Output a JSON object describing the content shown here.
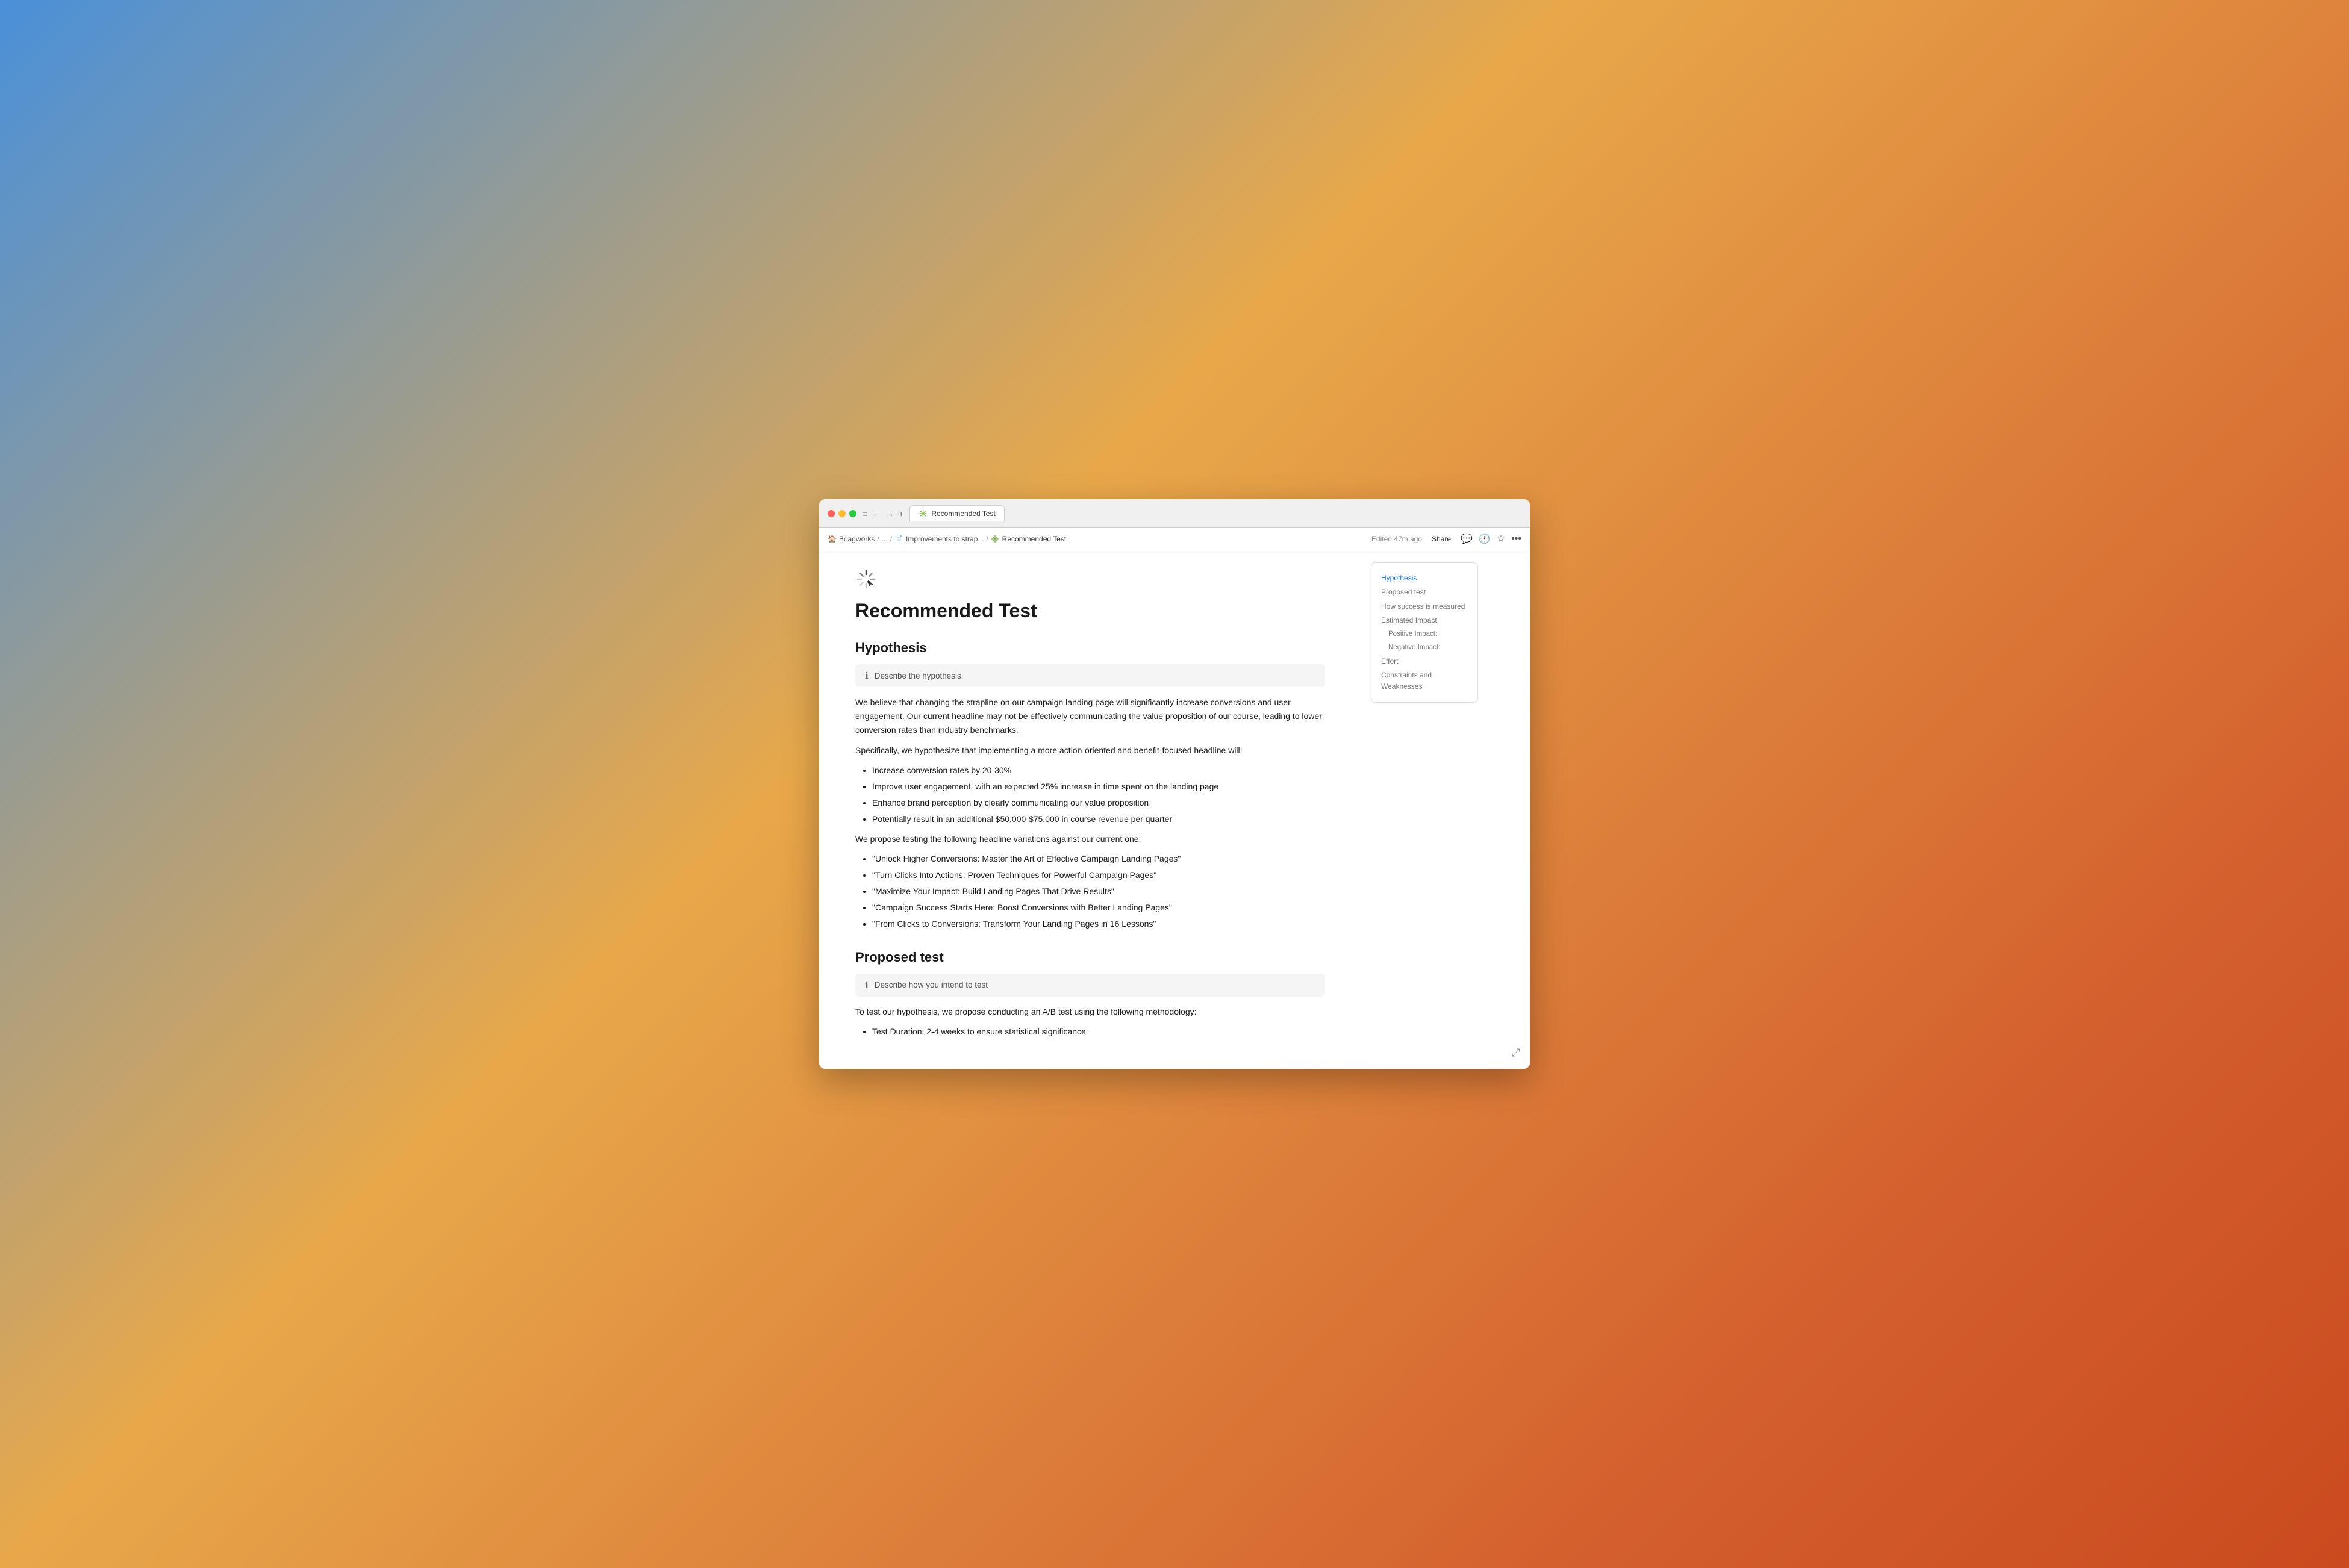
{
  "browser": {
    "tab_title": "Recommended Test",
    "tab_icon": "✳️",
    "nav_buttons": [
      "◉",
      "◉",
      "◉"
    ],
    "traffic_lights": [
      "red",
      "yellow",
      "green"
    ],
    "controls": [
      "≡",
      "←",
      "→",
      "+"
    ]
  },
  "breadcrumb": {
    "items": [
      {
        "label": "Boagworks",
        "icon": "🏠",
        "sep": "/"
      },
      {
        "label": "...",
        "sep": "/"
      },
      {
        "label": "Improvements to strap...",
        "icon": "📄",
        "sep": "/"
      },
      {
        "label": "Recommended Test",
        "icon": "✳️",
        "active": true
      }
    ]
  },
  "toolbar_right": {
    "edited_label": "Edited 47m ago",
    "share_label": "Share",
    "icons": [
      "💬",
      "🕐",
      "☆",
      "•••"
    ]
  },
  "toc": {
    "items": [
      {
        "label": "Hypothesis",
        "active": true,
        "sub": false
      },
      {
        "label": "Proposed test",
        "active": false,
        "sub": false
      },
      {
        "label": "How success is measured",
        "active": false,
        "sub": false
      },
      {
        "label": "Estimated Impact",
        "active": false,
        "sub": false
      },
      {
        "label": "Positive Impact:",
        "active": false,
        "sub": true
      },
      {
        "label": "Negative Impact:",
        "active": false,
        "sub": true
      },
      {
        "label": "Effort",
        "active": false,
        "sub": false
      },
      {
        "label": "Constraints and Weaknesses",
        "active": false,
        "sub": false
      }
    ]
  },
  "page": {
    "title": "Recommended Test",
    "hypothesis": {
      "heading": "Hypothesis",
      "hint": "Describe the hypothesis.",
      "paragraph1": "We believe that changing the strapline on our campaign landing page will significantly increase conversions and user engagement. Our current headline may not be effectively communicating the value proposition of our course, leading to lower conversion rates than industry benchmarks.",
      "paragraph2": "Specifically, we hypothesize that implementing a more action-oriented and benefit-focused headline will:",
      "bullets1": [
        "Increase conversion rates by 20-30%",
        "Improve user engagement, with an expected 25% increase in time spent on the landing page",
        "Enhance brand perception by clearly communicating our value proposition",
        "Potentially result in an additional $50,000-$75,000 in course revenue per quarter"
      ],
      "paragraph3": "We propose testing the following headline variations against our current one:",
      "bullets2": [
        "\"Unlock Higher Conversions: Master the Art of Effective Campaign Landing Pages\"",
        "\"Turn Clicks Into Actions: Proven Techniques for Powerful Campaign Pages\"",
        "\"Maximize Your Impact: Build Landing Pages That Drive Results\"",
        "\"Campaign Success Starts Here: Boost Conversions with Better Landing Pages\"",
        "\"From Clicks to Conversions: Transform Your Landing Pages in 16 Lessons\""
      ]
    },
    "proposed_test": {
      "heading": "Proposed test",
      "hint": "Describe how you intend to test",
      "paragraph1": "To test our hypothesis, we propose conducting an A/B test using the following methodology:",
      "bullets1": [
        "Test Duration: 2-4 weeks to ensure statistical significance"
      ]
    }
  }
}
